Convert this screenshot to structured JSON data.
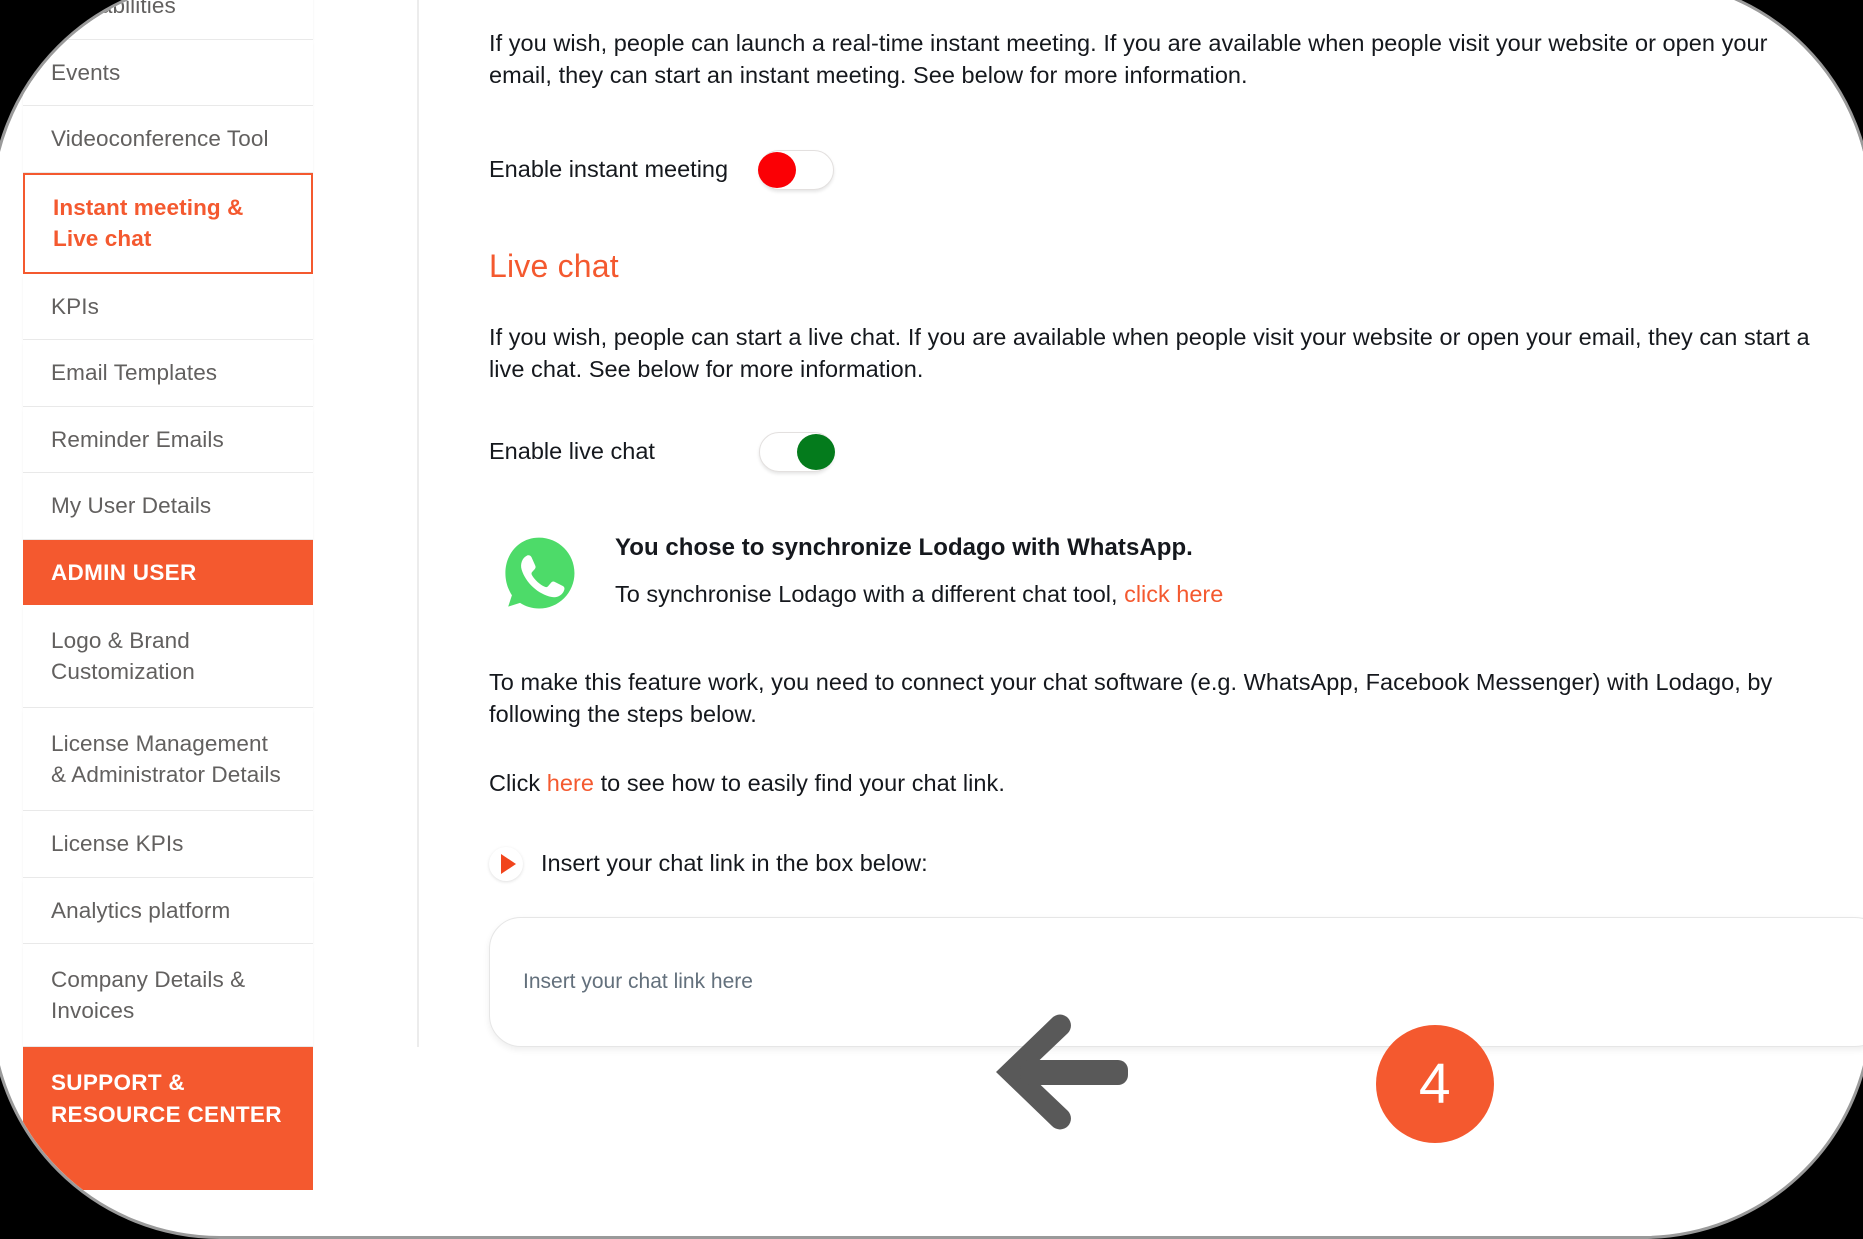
{
  "sidebar": {
    "items": [
      {
        "label": "Availabilities",
        "type": "item",
        "truncated": true
      },
      {
        "label": "Events",
        "type": "item"
      },
      {
        "label": "Videoconference Tool",
        "type": "item"
      },
      {
        "label": "Instant meeting & Live chat",
        "type": "item",
        "active": true
      },
      {
        "label": "KPIs",
        "type": "item"
      },
      {
        "label": "Email Templates",
        "type": "item"
      },
      {
        "label": "Reminder Emails",
        "type": "item"
      },
      {
        "label": "My User Details",
        "type": "item"
      },
      {
        "label": "ADMIN USER",
        "type": "section"
      },
      {
        "label": "Logo & Brand Customization",
        "type": "item",
        "tall": true
      },
      {
        "label": "License Management & Administrator Details",
        "type": "item",
        "tall": true
      },
      {
        "label": "License KPIs",
        "type": "item"
      },
      {
        "label": "Analytics platform",
        "type": "item"
      },
      {
        "label": "Company Details & Invoices",
        "type": "item",
        "tall": true
      },
      {
        "label": "SUPPORT & RESOURCE CENTER",
        "type": "section",
        "tall": true
      }
    ]
  },
  "main": {
    "instant_meeting": {
      "description": "If you wish, people can launch a real-time instant meeting. If you are available when people visit your website or open your email, they can start an instant meeting. See below for more information.",
      "toggle_label": "Enable instant meeting",
      "toggle_state": "off",
      "toggle_color": "#fb0005"
    },
    "live_chat": {
      "title": "Live chat",
      "description": "If you wish, people can start a live chat. If you are available when people visit your website or open your email, they can start a live chat. See below for more information.",
      "toggle_label": "Enable live chat",
      "toggle_state": "on",
      "toggle_color": "#047b1c"
    },
    "whatsapp_notice": {
      "icon": "whatsapp-icon",
      "title": "You chose to synchronize Lodago with WhatsApp.",
      "sub_prefix": "To synchronise Lodago with a different chat tool, ",
      "sub_link": "click here"
    },
    "connect_paragraph": "To make this feature work, you need to connect your chat software (e.g. WhatsApp, Facebook Messenger) with Lodago, by following the steps below.",
    "find_link_line": {
      "prefix": "Click ",
      "link": "here",
      "suffix": " to see how to easily find your chat link."
    },
    "insert_bullet": {
      "icon": "play-triangle-icon",
      "label": "Insert your chat link in the box below:"
    },
    "chat_link_input": {
      "placeholder": "Insert your chat link here",
      "value": ""
    }
  },
  "annotation": {
    "arrow_icon": "arrow-left-icon",
    "badge_number": "4",
    "badge_color": "#f4592f"
  }
}
